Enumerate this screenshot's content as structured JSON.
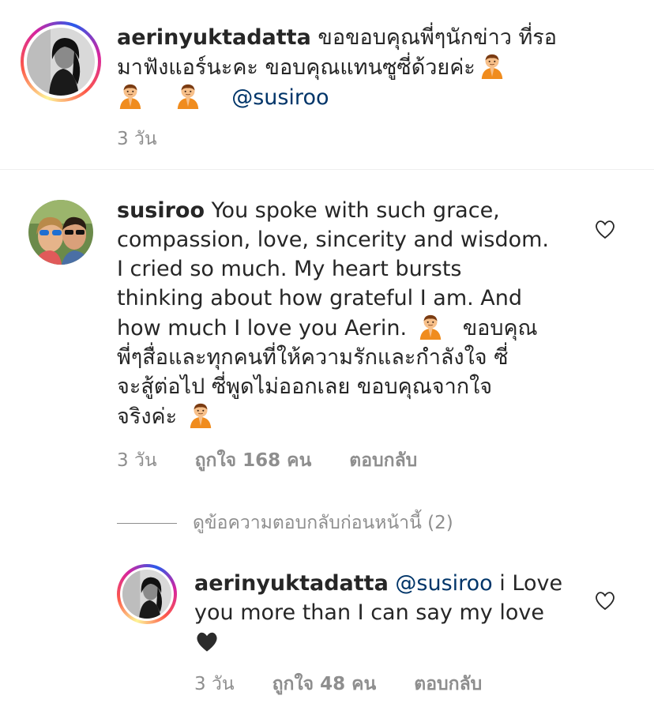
{
  "comments": [
    {
      "username": "aerinyuktadatta",
      "text1": "ขอขอบคุณพี่ๆนักข่าว ที่รอ",
      "text2": "มาฟังแอร์นะคะ ขอบคุณแทนซูซี่ด้วยค่ะ",
      "mention": "@susiroo",
      "time": "3 วัน"
    },
    {
      "username": "susiroo",
      "line1": "You spoke with such grace,",
      "line2": "compassion, love, sincerity and wisdom.",
      "line3": "I cried so much. My heart bursts",
      "line4": "thinking about how grateful I am. And",
      "line5a": "how much I love you Aerin.",
      "line5b": "ขอบคุณ",
      "line6": "พี่ๆสื่อและทุกคนที่ให้ความรักและกำลังใจ ซี่",
      "line7": "จะสู้ต่อไป ซี่พูดไม่ออกเลย ขอบคุณจากใจ",
      "line8": "จริงค่ะ",
      "time": "3 วัน",
      "likes": "ถูกใจ 168 คน",
      "reply": "ตอบกลับ"
    }
  ],
  "view_replies": "ดูข้อความตอบกลับก่อนหน้านี้ (2)",
  "reply": {
    "username": "aerinyuktadatta",
    "mention": "@susiroo",
    "text_a": "i Love",
    "text_b": "you more than I can say my love",
    "time": "3 วัน",
    "likes": "ถูกใจ 48 คน",
    "reply": "ตอบกลับ"
  },
  "colors": {
    "mention": "#003569",
    "meta": "#8e8e8e",
    "heart": "#262626"
  }
}
